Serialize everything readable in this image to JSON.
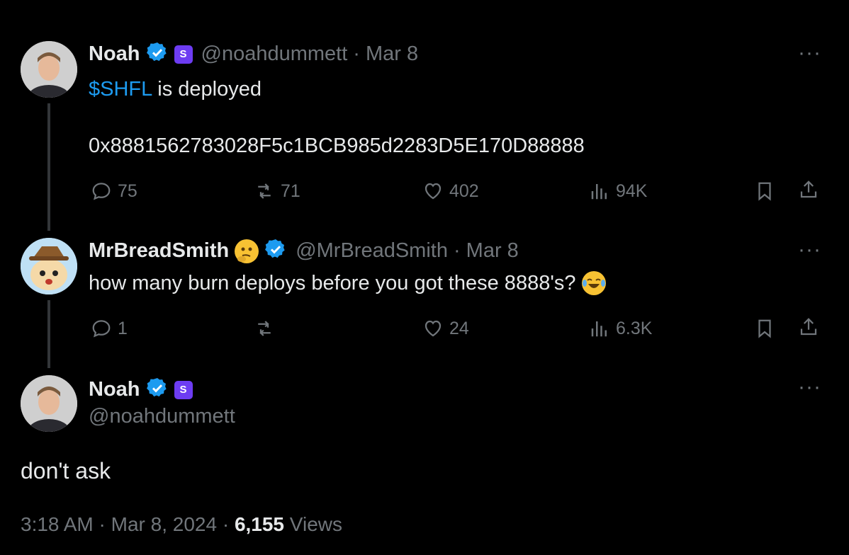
{
  "tweet1": {
    "name": "Noah",
    "handle": "@noahdummett",
    "sep": "·",
    "date": "Mar 8",
    "cashtag": "$SHFL",
    "text": " is deployed",
    "address": "0x8881562783028F5c1BCB985d2283D5E170D88888",
    "replies": "75",
    "reposts": "71",
    "likes": "402",
    "views": "94K",
    "more": "···"
  },
  "tweet2": {
    "name": "MrBreadSmith",
    "handle": "@MrBreadSmith",
    "sep": "·",
    "date": "Mar 8",
    "text": "how many burn deploys before you got these 8888's?",
    "replies": "1",
    "reposts": "",
    "likes": "24",
    "views": "6.3K",
    "more": "···"
  },
  "tweet3": {
    "name": "Noah",
    "handle": "@noahdummett",
    "text": "don't ask",
    "time": "3:18 AM",
    "sep1": "·",
    "date": "Mar 8, 2024",
    "sep2": "·",
    "views": "6,155",
    "views_label": "Views",
    "more": "···"
  },
  "colors": {
    "background": "#000000",
    "text": "#e7e9ea",
    "muted": "#71767b",
    "link": "#1d9bf0",
    "verified": "#1d9bf0",
    "badge": "#6d3cf2"
  },
  "icons": [
    "reply-icon",
    "repost-icon",
    "like-icon",
    "views-icon",
    "bookmark-icon",
    "share-icon",
    "verified-icon",
    "more-icon",
    "thinking-emoji",
    "laughing-emoji"
  ]
}
